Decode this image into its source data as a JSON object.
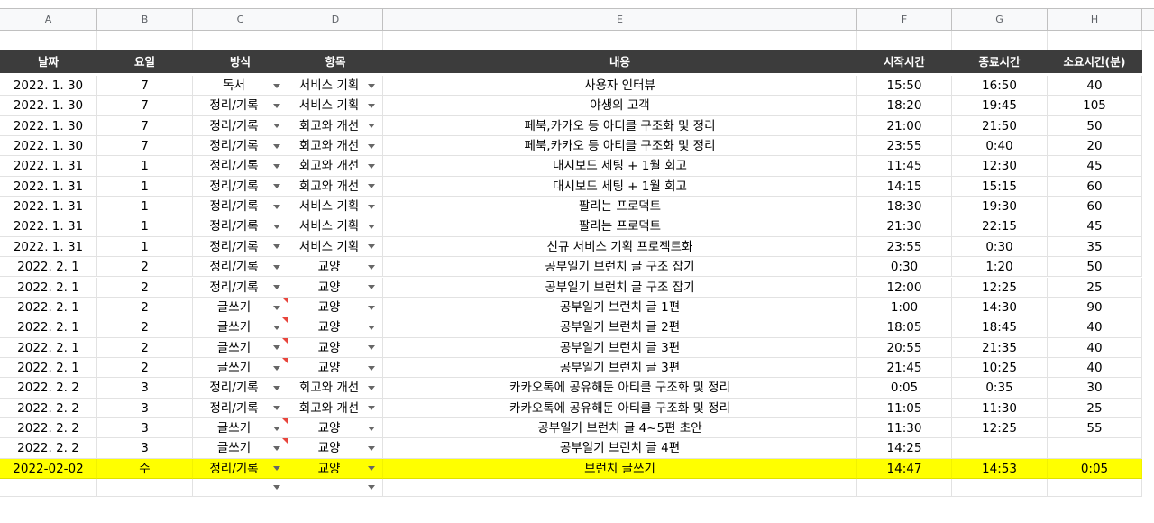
{
  "column_letters": [
    "A",
    "B",
    "C",
    "D",
    "E",
    "F",
    "G",
    "H"
  ],
  "header": [
    "날짜",
    "요일",
    "방식",
    "항목",
    "내용",
    "시작시간",
    "종료시간",
    "소요시간(분)"
  ],
  "rows": [
    {
      "date": "2022. 1. 30",
      "day": "7",
      "method": "독서",
      "item": "서비스 기획",
      "content": "사용자 인터뷰",
      "start": "15:50",
      "end": "16:50",
      "duration": "40",
      "note": false
    },
    {
      "date": "2022. 1. 30",
      "day": "7",
      "method": "정리/기록",
      "item": "서비스 기획",
      "content": "야생의 고객",
      "start": "18:20",
      "end": "19:45",
      "duration": "105",
      "note": false
    },
    {
      "date": "2022. 1. 30",
      "day": "7",
      "method": "정리/기록",
      "item": "회고와 개선",
      "content": "페북,카카오 등 아티클 구조화 및 정리",
      "start": "21:00",
      "end": "21:50",
      "duration": "50",
      "note": false
    },
    {
      "date": "2022. 1. 30",
      "day": "7",
      "method": "정리/기록",
      "item": "회고와 개선",
      "content": "페북,카카오 등 아티클 구조화 및 정리",
      "start": "23:55",
      "end": "0:40",
      "duration": "20",
      "note": false
    },
    {
      "date": "2022. 1. 31",
      "day": "1",
      "method": "정리/기록",
      "item": "회고와 개선",
      "content": "대시보드 세팅 + 1월 회고",
      "start": "11:45",
      "end": "12:30",
      "duration": "45",
      "note": false
    },
    {
      "date": "2022. 1. 31",
      "day": "1",
      "method": "정리/기록",
      "item": "회고와 개선",
      "content": "대시보드 세팅 + 1월 회고",
      "start": "14:15",
      "end": "15:15",
      "duration": "60",
      "note": false
    },
    {
      "date": "2022. 1. 31",
      "day": "1",
      "method": "정리/기록",
      "item": "서비스 기획",
      "content": "팔리는 프로덕트",
      "start": "18:30",
      "end": "19:30",
      "duration": "60",
      "note": false
    },
    {
      "date": "2022. 1. 31",
      "day": "1",
      "method": "정리/기록",
      "item": "서비스 기획",
      "content": "팔리는 프로덕트",
      "start": "21:30",
      "end": "22:15",
      "duration": "45",
      "note": false
    },
    {
      "date": "2022. 1. 31",
      "day": "1",
      "method": "정리/기록",
      "item": "서비스 기획",
      "content": "신규 서비스 기획 프로젝트화",
      "start": "23:55",
      "end": "0:30",
      "duration": "35",
      "note": false
    },
    {
      "date": "2022. 2. 1",
      "day": "2",
      "method": "정리/기록",
      "item": "교양",
      "content": "공부일기 브런치 글 구조 잡기",
      "start": "0:30",
      "end": "1:20",
      "duration": "50",
      "note": false
    },
    {
      "date": "2022. 2. 1",
      "day": "2",
      "method": "정리/기록",
      "item": "교양",
      "content": "공부일기 브런치 글 구조 잡기",
      "start": "12:00",
      "end": "12:25",
      "duration": "25",
      "note": false
    },
    {
      "date": "2022. 2. 1",
      "day": "2",
      "method": "글쓰기",
      "item": "교양",
      "content": "공부일기 브런치 글 1편",
      "start": "1:00",
      "end": "14:30",
      "duration": "90",
      "note": true
    },
    {
      "date": "2022. 2. 1",
      "day": "2",
      "method": "글쓰기",
      "item": "교양",
      "content": "공부일기 브런치 글 2편",
      "start": "18:05",
      "end": "18:45",
      "duration": "40",
      "note": true
    },
    {
      "date": "2022. 2. 1",
      "day": "2",
      "method": "글쓰기",
      "item": "교양",
      "content": "공부일기 브런치 글 3편",
      "start": "20:55",
      "end": "21:35",
      "duration": "40",
      "note": true
    },
    {
      "date": "2022. 2. 1",
      "day": "2",
      "method": "글쓰기",
      "item": "교양",
      "content": "공부일기 브런치 글 3편",
      "start": "21:45",
      "end": "10:25",
      "duration": "40",
      "note": true
    },
    {
      "date": "2022. 2. 2",
      "day": "3",
      "method": "정리/기록",
      "item": "회고와 개선",
      "content": "카카오톡에 공유해둔 아티클 구조화 및 정리",
      "start": "0:05",
      "end": "0:35",
      "duration": "30",
      "note": false
    },
    {
      "date": "2022. 2. 2",
      "day": "3",
      "method": "정리/기록",
      "item": "회고와 개선",
      "content": "카카오톡에 공유해둔 아티클 구조화 및 정리",
      "start": "11:05",
      "end": "11:30",
      "duration": "25",
      "note": false
    },
    {
      "date": "2022. 2. 2",
      "day": "3",
      "method": "글쓰기",
      "item": "교양",
      "content": "공부일기 브런치 글 4~5편 초안",
      "start": "11:30",
      "end": "12:25",
      "duration": "55",
      "note": true
    },
    {
      "date": "2022. 2. 2",
      "day": "3",
      "method": "글쓰기",
      "item": "교양",
      "content": "공부일기 브런치 글 4편",
      "start": "14:25",
      "end": "",
      "duration": "",
      "note": true
    }
  ],
  "highlight_row": {
    "date": "2022-02-02",
    "day": "수",
    "method": "정리/기록",
    "item": "교양",
    "content": "브런치 글쓰기",
    "start": "14:47",
    "end": "14:53",
    "duration": "0:05"
  },
  "colors": {
    "header_bg": "#3c3c3c",
    "header_fg": "#ffffff",
    "highlight": "#ffff00",
    "note_marker": "#e8453c"
  }
}
